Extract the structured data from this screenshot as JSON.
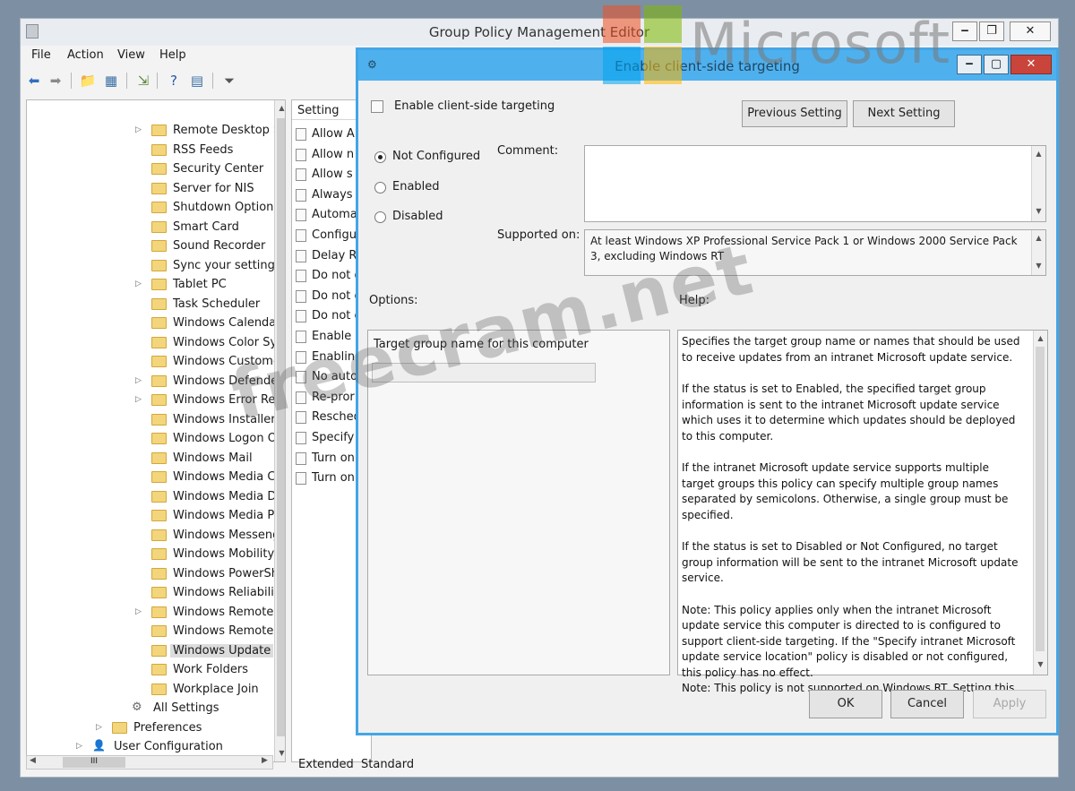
{
  "main_window": {
    "title": "Group Policy Management Editor",
    "buttons": {
      "minimize": "‒",
      "restore": "❐",
      "close": "✕"
    }
  },
  "menu": [
    "File",
    "Action",
    "View",
    "Help"
  ],
  "tree": [
    {
      "label": "Remote Desktop Servic",
      "indent": 2,
      "expandable": true
    },
    {
      "label": "RSS Feeds",
      "indent": 2,
      "expandable": false
    },
    {
      "label": "Security Center",
      "indent": 2,
      "expandable": false
    },
    {
      "label": "Server for NIS",
      "indent": 2,
      "expandable": false
    },
    {
      "label": "Shutdown Options",
      "indent": 2,
      "expandable": false
    },
    {
      "label": "Smart Card",
      "indent": 2,
      "expandable": false
    },
    {
      "label": "Sound Recorder",
      "indent": 2,
      "expandable": false
    },
    {
      "label": "Sync your settings",
      "indent": 2,
      "expandable": false
    },
    {
      "label": "Tablet PC",
      "indent": 2,
      "expandable": true
    },
    {
      "label": "Task Scheduler",
      "indent": 2,
      "expandable": false
    },
    {
      "label": "Windows Calendar",
      "indent": 2,
      "expandable": false
    },
    {
      "label": "Windows Color System",
      "indent": 2,
      "expandable": false
    },
    {
      "label": "Windows Customer Ex",
      "indent": 2,
      "expandable": false
    },
    {
      "label": "Windows Defender",
      "indent": 2,
      "expandable": true
    },
    {
      "label": "Windows Error Reporti",
      "indent": 2,
      "expandable": true
    },
    {
      "label": "Windows Installer",
      "indent": 2,
      "expandable": false
    },
    {
      "label": "Windows Logon Optio",
      "indent": 2,
      "expandable": false
    },
    {
      "label": "Windows Mail",
      "indent": 2,
      "expandable": false
    },
    {
      "label": "Windows Media Cente",
      "indent": 2,
      "expandable": false
    },
    {
      "label": "Windows Media Digita",
      "indent": 2,
      "expandable": false
    },
    {
      "label": "Windows Media Player",
      "indent": 2,
      "expandable": false
    },
    {
      "label": "Windows Messenger",
      "indent": 2,
      "expandable": false
    },
    {
      "label": "Windows Mobility Cen",
      "indent": 2,
      "expandable": false
    },
    {
      "label": "Windows PowerShell",
      "indent": 2,
      "expandable": false
    },
    {
      "label": "Windows Reliability An",
      "indent": 2,
      "expandable": false
    },
    {
      "label": "Windows Remote Man",
      "indent": 2,
      "expandable": true
    },
    {
      "label": "Windows Remote Shell",
      "indent": 2,
      "expandable": false
    },
    {
      "label": "Windows Update",
      "indent": 2,
      "expandable": false,
      "selected": true
    },
    {
      "label": "Work Folders",
      "indent": 2,
      "expandable": false
    },
    {
      "label": "Workplace Join",
      "indent": 2,
      "expandable": false
    },
    {
      "label": "All Settings",
      "indent": 1,
      "expandable": false,
      "icon": "settings"
    },
    {
      "label": "Preferences",
      "indent": 0,
      "expandable": true
    },
    {
      "label": "User Configuration",
      "indent": -1,
      "expandable": true,
      "icon": "user"
    }
  ],
  "settings_list": {
    "header": "Setting",
    "items": [
      "Allow A",
      "Allow n",
      "Allow s",
      "Always a",
      "Automa",
      "Configu",
      "Delay Re",
      "Do not d",
      "Do not c",
      "Do not c",
      "Enable c",
      "Enablin",
      "No auto",
      "Re-pror",
      "Resched",
      "Specify",
      "Turn on",
      "Turn on"
    ],
    "tabs": [
      "Extended",
      "Standard"
    ]
  },
  "scroll_labels": {
    "tree_hscroll_thumb": "III"
  },
  "dialog": {
    "title": "Enable client-side targeting",
    "setting_name": "Enable client-side targeting",
    "buttons": {
      "previous": "Previous Setting",
      "next": "Next Setting",
      "ok": "OK",
      "cancel": "Cancel",
      "apply": "Apply"
    },
    "radios": [
      {
        "label": "Not Configured",
        "checked": true
      },
      {
        "label": "Enabled",
        "checked": false
      },
      {
        "label": "Disabled",
        "checked": false
      }
    ],
    "comment_label": "Comment:",
    "comment_value": "",
    "supported_label": "Supported on:",
    "supported_value": "At least Windows XP Professional Service Pack 1 or Windows 2000 Service Pack 3, excluding Windows RT",
    "options_label": "Options:",
    "help_label": "Help:",
    "option_field_label": "Target group name for this computer",
    "option_field_value": "",
    "help_paragraphs": [
      "Specifies the target group name or names that should be used to receive updates from an intranet Microsoft update service.",
      "If the status is set to Enabled, the specified target group information is sent to the intranet Microsoft update service which uses it to determine which updates should be deployed to this computer.",
      "If the intranet Microsoft update service supports multiple target groups this policy can specify multiple group names separated by semicolons. Otherwise, a single group must be specified.",
      "If the status is set to Disabled or Not Configured, no target group information will be sent to the intranet Microsoft update service.",
      "Note: This policy applies only when the intranet Microsoft update service this computer is directed to is configured to support client-side targeting. If the \"Specify intranet Microsoft update service location\" policy is disabled or not configured, this policy has no effect.\nNote: This policy is not supported on Windows RT. Setting this"
    ]
  },
  "watermarks": {
    "microsoft": "Microsoft",
    "freecram": "freecram.net"
  },
  "colors": {
    "dialog_accent": "#4fb0ee",
    "close_red": "#c9443a",
    "folder": "#f3d57c"
  }
}
